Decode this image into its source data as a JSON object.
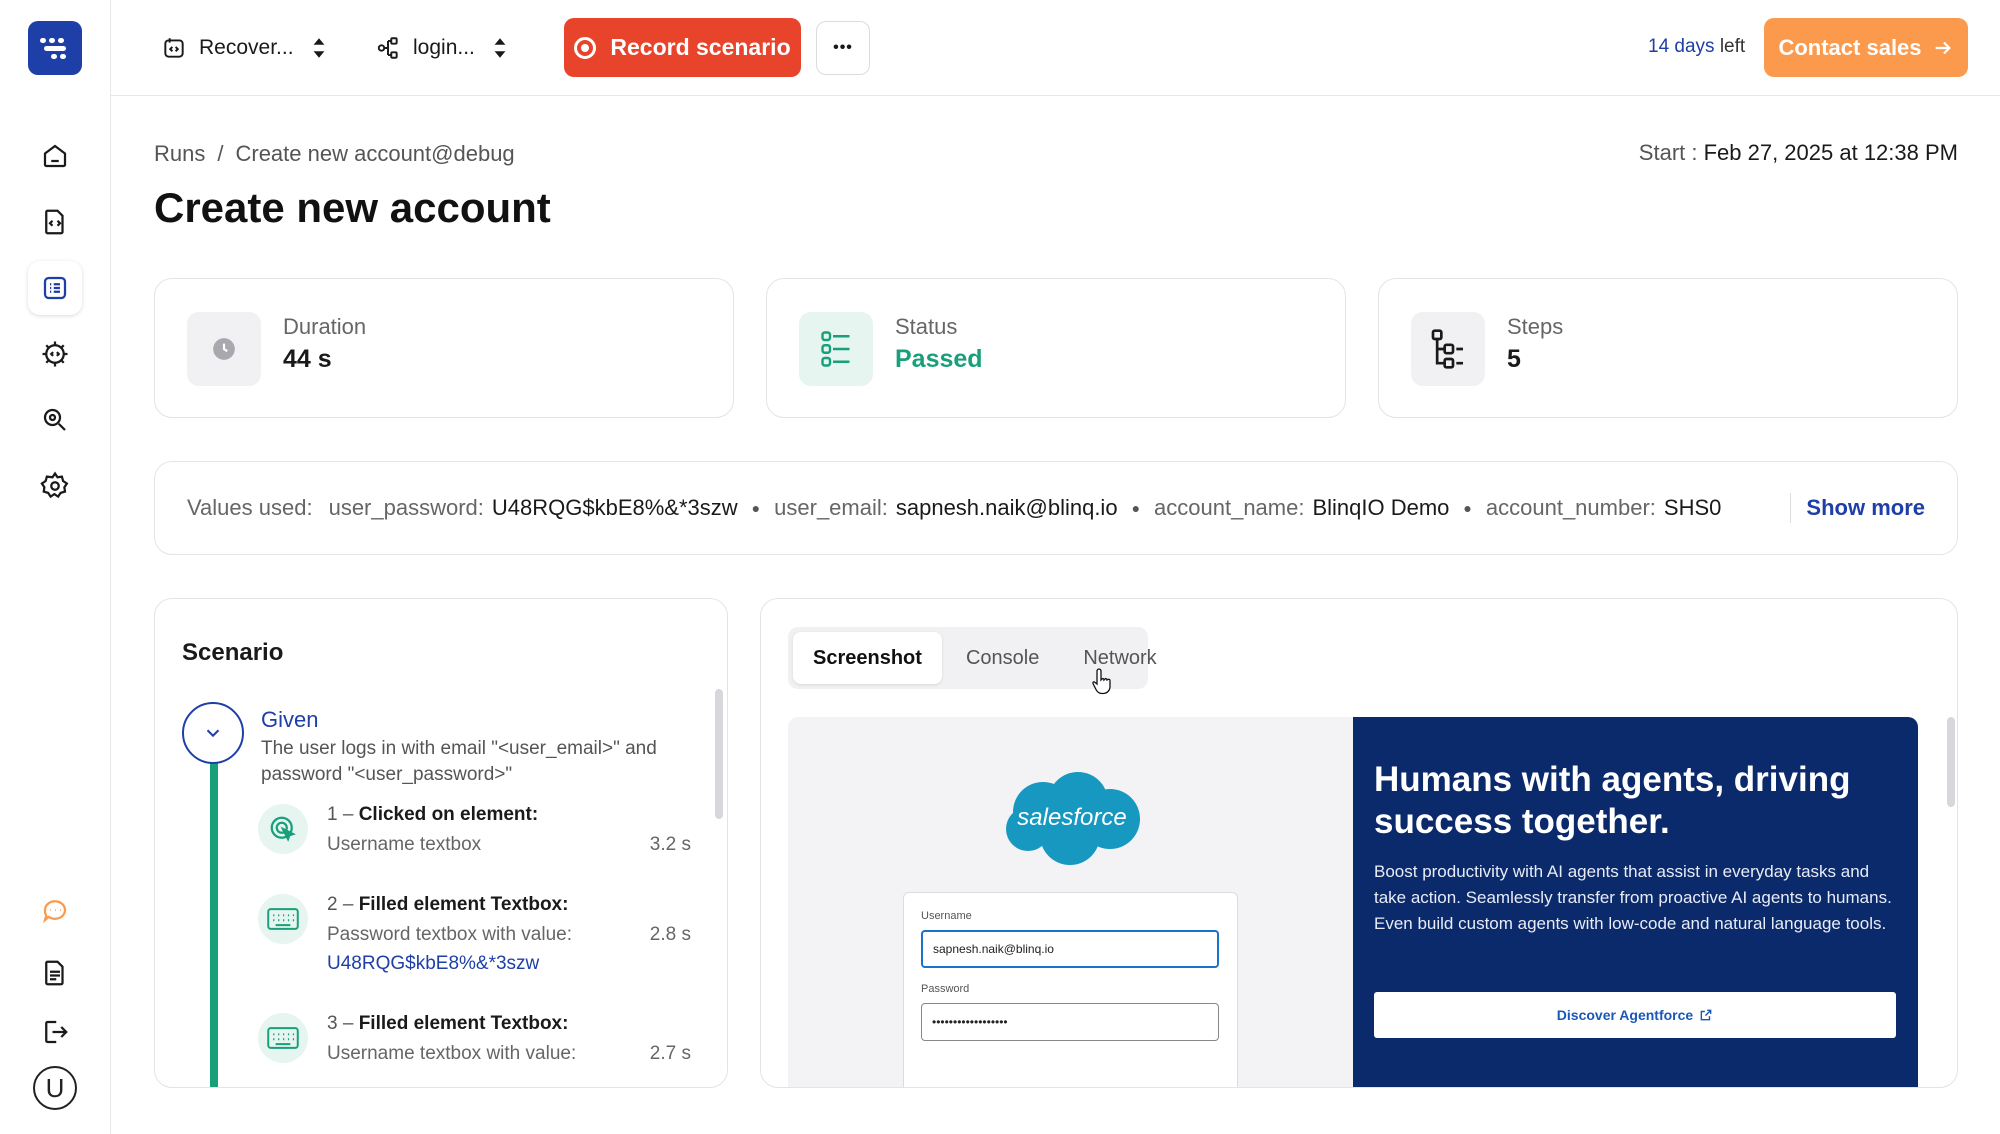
{
  "topbar": {
    "project_selector": "Recover...",
    "flow_selector": "login...",
    "record_label": "Record scenario",
    "more_label": "•••",
    "trial_days": "14 days",
    "trial_left": " left",
    "contact_label": "Contact sales"
  },
  "sidebar": {
    "items": [
      {
        "icon": "home-icon"
      },
      {
        "icon": "code-file-icon"
      },
      {
        "icon": "runs-list-icon"
      },
      {
        "icon": "gear-code-icon"
      },
      {
        "icon": "search-icon"
      },
      {
        "icon": "settings-icon"
      },
      {
        "icon": "chat-icon"
      },
      {
        "icon": "docs-icon"
      },
      {
        "icon": "logout-icon"
      }
    ],
    "avatar_letter": "U"
  },
  "header": {
    "breadcrumb_root": "Runs",
    "breadcrumb_sep": "/",
    "breadcrumb_current": "Create new account@debug",
    "start_label": "Start : ",
    "start_value": "Feb 27, 2025 at 12:38 PM",
    "title": "Create new account"
  },
  "stats": {
    "duration_label": "Duration",
    "duration_value": "44 s",
    "status_label": "Status",
    "status_value": "Passed",
    "steps_label": "Steps",
    "steps_value": "5"
  },
  "values_used": {
    "label": "Values used:",
    "items": [
      {
        "key": "user_password:",
        "value": "U48RQG$kbE8%&*3szw"
      },
      {
        "key": "user_email:",
        "value": "sapnesh.naik@blinq.io"
      },
      {
        "key": "account_name:",
        "value": "BlinqIO Demo"
      },
      {
        "key": "account_number:",
        "value": "SHS0"
      }
    ],
    "show_more": "Show more"
  },
  "scenario": {
    "title": "Scenario",
    "given_label": "Given",
    "given_desc": "The user logs in with email \"<user_email>\" and password \"<user_password>\"",
    "steps": [
      {
        "num": "1 – ",
        "title": "Clicked on element:",
        "sub": "Username textbox",
        "link": "",
        "time": "3.2 s"
      },
      {
        "num": "2 – ",
        "title": "Filled element Textbox:",
        "sub": "Password textbox with value:",
        "link": "U48RQG$kbE8%&*3szw",
        "time": "2.8 s"
      },
      {
        "num": "3 – ",
        "title": "Filled element Textbox:",
        "sub": "Username textbox with value:",
        "link": "",
        "time": "2.7 s"
      }
    ]
  },
  "viewer": {
    "tabs": [
      "Screenshot",
      "Console",
      "Network"
    ],
    "active_tab": "Screenshot",
    "shot": {
      "brand": "salesforce",
      "username_label": "Username",
      "username_value": "sapnesh.naik@blinq.io",
      "password_label": "Password",
      "password_value": "••••••••••••••••••",
      "hero_title": "Humans with agents, driving success together.",
      "hero_text": "Boost productivity with AI agents that assist in everyday tasks and take action. Seamlessly transfer from proactive AI agents to humans. Even build custom agents with low-code and natural language tools.",
      "hero_button": "Discover Agentforce"
    }
  },
  "colors": {
    "brand_blue": "#1f3fa8",
    "record_red": "#e8442b",
    "contact_orange": "#fb9a4c",
    "passed_green": "#18a07a",
    "sf_navy": "#0b2a6b"
  }
}
